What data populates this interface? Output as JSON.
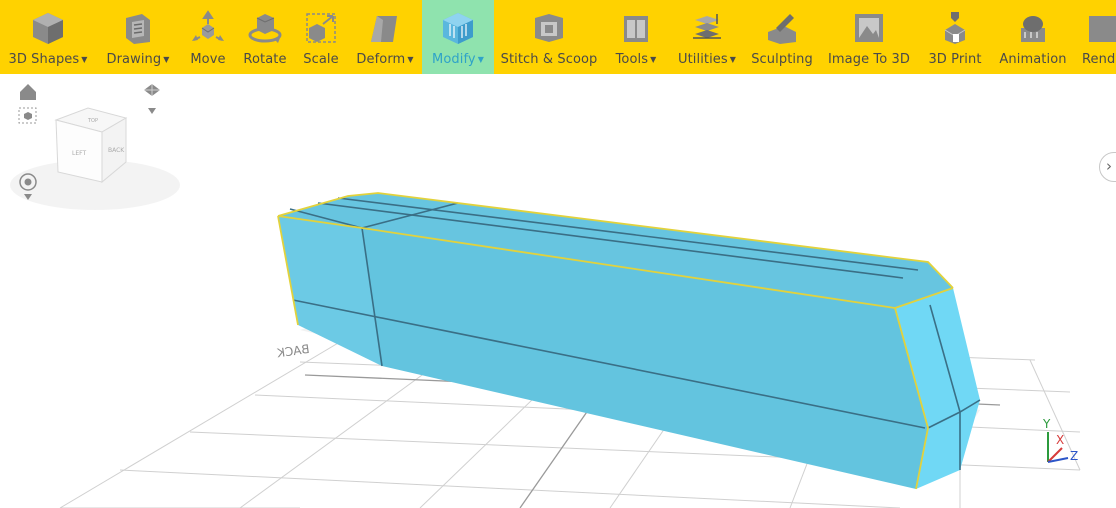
{
  "toolbar": {
    "items": [
      {
        "label": "3D Shapes",
        "dropdown": true,
        "icon": "cube-icon"
      },
      {
        "label": "Drawing",
        "dropdown": true,
        "icon": "drawing-icon"
      },
      {
        "label": "Move",
        "dropdown": false,
        "icon": "move-icon"
      },
      {
        "label": "Rotate",
        "dropdown": false,
        "icon": "rotate-icon"
      },
      {
        "label": "Scale",
        "dropdown": false,
        "icon": "scale-icon"
      },
      {
        "label": "Deform",
        "dropdown": true,
        "icon": "deform-icon"
      },
      {
        "label": "Modify",
        "dropdown": true,
        "icon": "modify-icon",
        "active": true
      },
      {
        "label": "Stitch & Scoop",
        "dropdown": false,
        "icon": "stitch-scoop-icon"
      },
      {
        "label": "Tools",
        "dropdown": true,
        "icon": "tools-icon"
      },
      {
        "label": "Utilities",
        "dropdown": true,
        "icon": "utilities-icon"
      },
      {
        "label": "Sculpting",
        "dropdown": false,
        "icon": "sculpting-icon"
      },
      {
        "label": "Image To 3D",
        "dropdown": false,
        "icon": "image-to-3d-icon"
      },
      {
        "label": "3D Print",
        "dropdown": false,
        "icon": "3d-print-icon"
      },
      {
        "label": "Animation",
        "dropdown": false,
        "icon": "animation-icon"
      },
      {
        "label": "Rend",
        "dropdown": false,
        "icon": "render-icon"
      }
    ],
    "colors": {
      "background": "#ffd200",
      "active": "#8fe3ae",
      "active_text": "#2fa3c8",
      "text": "#4a4a4a"
    }
  },
  "viewport": {
    "view_cube": {
      "left_face": "LEFT",
      "right_face": "BACK",
      "top_face": "TOP"
    },
    "grid_label": "BACK",
    "axes": {
      "x": "X",
      "y": "Y",
      "z": "Z"
    },
    "model_color": "#64c6e2",
    "selection_color": "#e6d94a"
  }
}
